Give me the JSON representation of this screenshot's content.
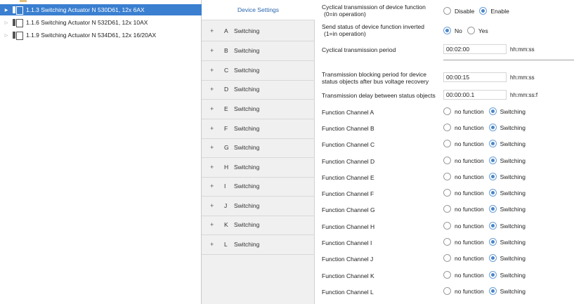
{
  "tree": {
    "items": [
      {
        "label": "1.1.3 Switching Actuator N 530D61, 12x 6AX",
        "selected": true
      },
      {
        "label": "1.1.6 Switching Actuator N 532D61, 12x 10AX",
        "selected": false
      },
      {
        "label": "1.1.9 Switching Actuator N 534D61, 12x 16/20AX",
        "selected": false
      }
    ]
  },
  "nav": {
    "active_label": "Device Settings",
    "items": [
      {
        "plus": "+",
        "letter": "A",
        "text": "Switching"
      },
      {
        "plus": "+",
        "letter": "B",
        "text": "Switching"
      },
      {
        "plus": "+",
        "letter": "C",
        "text": "Switching"
      },
      {
        "plus": "+",
        "letter": "D",
        "text": "Switching"
      },
      {
        "plus": "+",
        "letter": "E",
        "text": "Switching"
      },
      {
        "plus": "+",
        "letter": "F",
        "text": "Switching"
      },
      {
        "plus": "+",
        "letter": "G",
        "text": "Switching"
      },
      {
        "plus": "+",
        "letter": "H",
        "text": "Switching"
      },
      {
        "plus": "+",
        "letter": "I",
        "text": "Switching"
      },
      {
        "plus": "+",
        "letter": "J",
        "text": "Switching"
      },
      {
        "plus": "+",
        "letter": "K",
        "text": "Switching"
      },
      {
        "plus": "+",
        "letter": "L",
        "text": "Switching"
      }
    ]
  },
  "params": {
    "cyclical_function": {
      "label_line1": "Cyclical transmission of device function",
      "label_line2": "(0=in operation)",
      "options": [
        "Disable",
        "Enable"
      ],
      "selected": "Enable"
    },
    "send_inverted": {
      "label_line1": "Send status of device function inverted",
      "label_line2": "(1=in operation)",
      "options": [
        "No",
        "Yes"
      ],
      "selected": "No"
    },
    "cyclical_period": {
      "label": "Cyclical transmission period",
      "value": "00:02:00",
      "unit": "hh:mm:ss"
    },
    "blocking_period": {
      "label_line1": "Transmission blocking period for device",
      "label_line2": "status objects after bus voltage recovery",
      "value": "00:00:15",
      "unit": "hh:mm:ss"
    },
    "status_delay": {
      "label": "Transmission delay between status objects",
      "value": "00:00:00.1",
      "unit": "hh:mm:ss:f"
    },
    "channels": [
      {
        "label": "Function Channel A",
        "options": [
          "no function",
          "Switching"
        ],
        "selected": "Switching"
      },
      {
        "label": "Function Channel B",
        "options": [
          "no function",
          "Switching"
        ],
        "selected": "Switching"
      },
      {
        "label": "Function Channel C",
        "options": [
          "no function",
          "Switching"
        ],
        "selected": "Switching"
      },
      {
        "label": "Function Channel D",
        "options": [
          "no function",
          "Switching"
        ],
        "selected": "Switching"
      },
      {
        "label": "Function Channel E",
        "options": [
          "no function",
          "Switching"
        ],
        "selected": "Switching"
      },
      {
        "label": "Function Channel F",
        "options": [
          "no function",
          "Switching"
        ],
        "selected": "Switching"
      },
      {
        "label": "Function Channel G",
        "options": [
          "no function",
          "Switching"
        ],
        "selected": "Switching"
      },
      {
        "label": "Function Channel H",
        "options": [
          "no function",
          "Switching"
        ],
        "selected": "Switching"
      },
      {
        "label": "Function Channel I",
        "options": [
          "no function",
          "Switching"
        ],
        "selected": "Switching"
      },
      {
        "label": "Function Channel J",
        "options": [
          "no function",
          "Switching"
        ],
        "selected": "Switching"
      },
      {
        "label": "Function Channel K",
        "options": [
          "no function",
          "Switching"
        ],
        "selected": "Switching"
      },
      {
        "label": "Function Channel L",
        "options": [
          "no function",
          "Switching"
        ],
        "selected": "Switching"
      }
    ]
  },
  "colors": {
    "selection": "#3a7fd0",
    "nav_background": "#f0f0f0",
    "radio_checked": "#4a86c8",
    "nav_active_text": "#2a66b0"
  }
}
